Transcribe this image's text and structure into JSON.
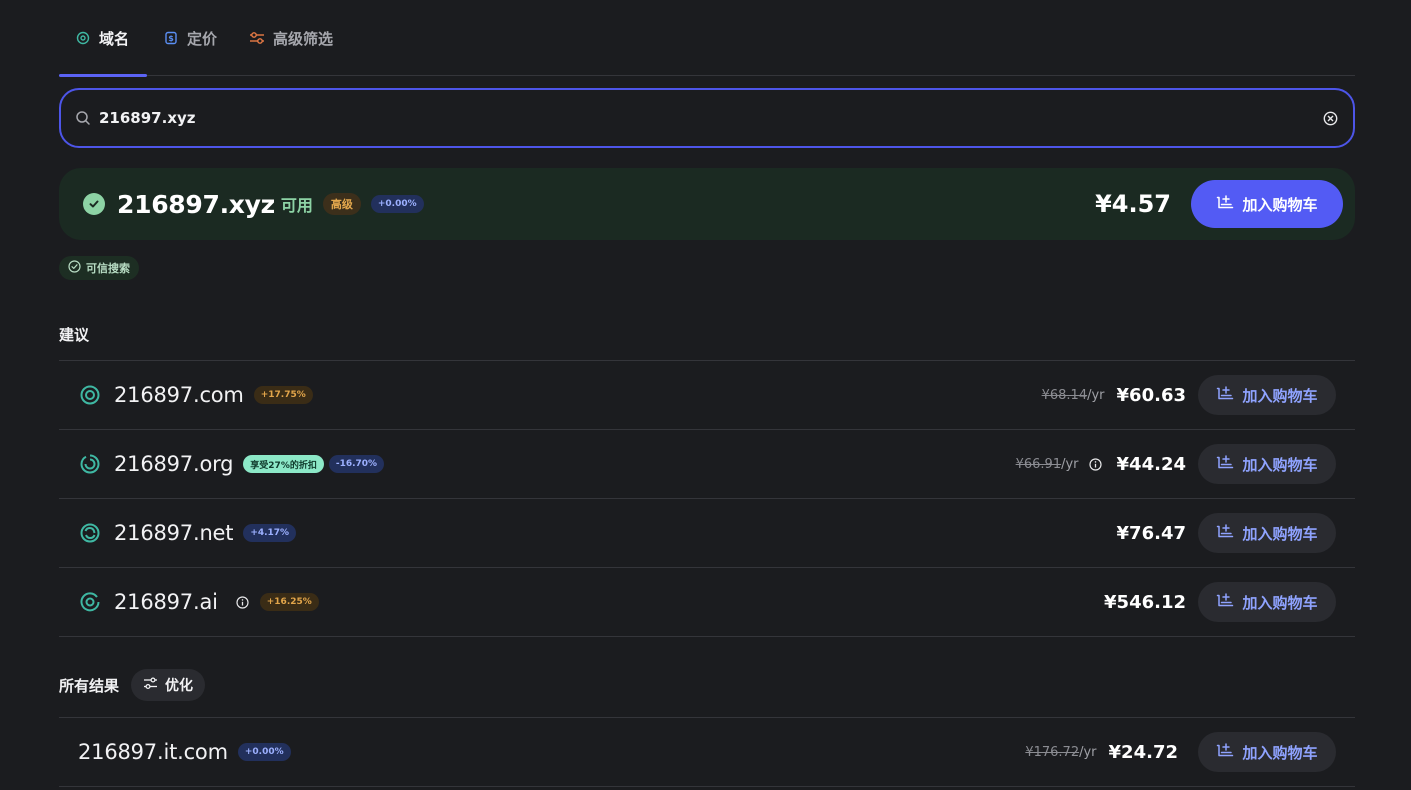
{
  "tabs": [
    {
      "label": "域名",
      "icon": "domain-icon",
      "active": true
    },
    {
      "label": "定价",
      "icon": "pricing-icon",
      "active": false
    },
    {
      "label": "高级筛选",
      "icon": "filter-icon",
      "active": false
    }
  ],
  "search": {
    "value": "216897.xyz"
  },
  "featured": {
    "domain": "216897.xyz",
    "status": "可用",
    "premium_badge": "高级",
    "change": "+0.00%",
    "price": "¥4.57",
    "cart_label": "加入购物车"
  },
  "trusted_label": "可信搜索",
  "suggestions": {
    "title": "建议",
    "items": [
      {
        "domain": "216897.com",
        "icon": "target-icon",
        "badges": [
          {
            "text": "+17.75%",
            "style": "amber"
          }
        ],
        "old_price": "¥68.14",
        "per": "/yr",
        "price": "¥60.63",
        "cart_label": "加入购物车"
      },
      {
        "domain": "216897.org",
        "icon": "org-swirl-icon",
        "badges": [
          {
            "text": "享受27%的折扣",
            "style": "mint"
          },
          {
            "text": "-16.70%",
            "style": "blue"
          }
        ],
        "old_price": "¥66.91",
        "per": "/yr",
        "price": "¥44.24",
        "cart_label": "加入购物车"
      },
      {
        "domain": "216897.net",
        "icon": "net-swirl-icon",
        "badges": [
          {
            "text": "+4.17%",
            "style": "blue"
          }
        ],
        "old_price": "",
        "per": "",
        "price": "¥76.47",
        "cart_label": "加入购物车"
      },
      {
        "domain": "216897.ai",
        "icon": "ai-ring-icon",
        "badges": [
          {
            "text": "+16.25%",
            "style": "amber"
          }
        ],
        "old_price": "",
        "per": "",
        "price": "¥546.12",
        "cart_label": "加入购物车"
      }
    ]
  },
  "all_results": {
    "title": "所有结果",
    "optimize_label": "优化",
    "items": [
      {
        "domain": "216897.it.com",
        "badges": [
          {
            "text": "+0.00%",
            "style": "blue"
          }
        ],
        "old_price": "¥176.72",
        "per": "/yr",
        "price": "¥24.72",
        "cart_label": "加入购物车"
      }
    ]
  },
  "colors": {
    "accent": "#535bf4",
    "available": "#8dd3a5",
    "domain_icon": "#3fb8a3",
    "background": "#1b1c1f"
  }
}
